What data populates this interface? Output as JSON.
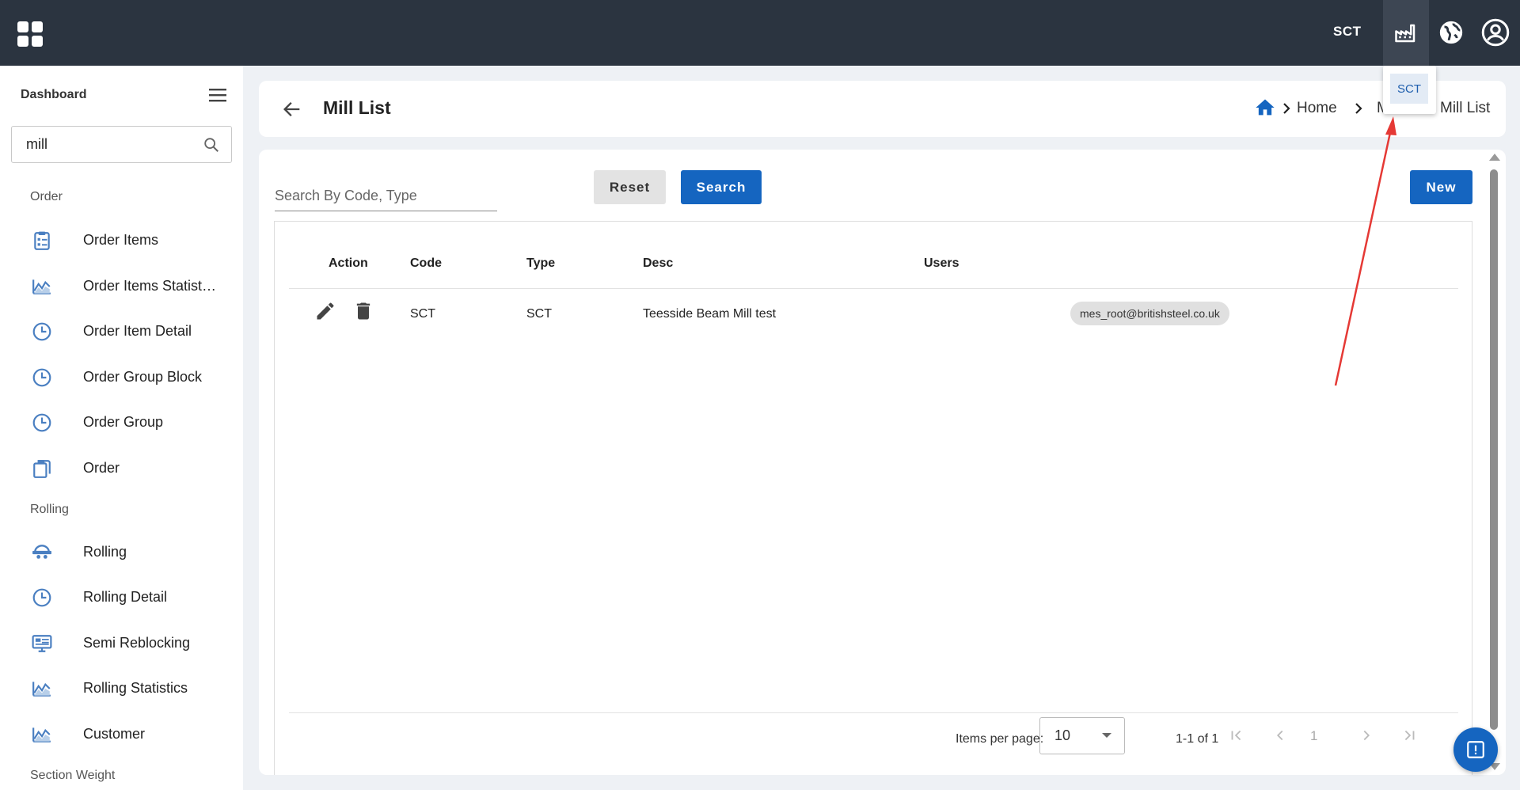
{
  "topbar": {
    "mill_code": "SCT",
    "mill_dropdown": {
      "options": [
        "SCT"
      ],
      "selected": "SCT"
    }
  },
  "sidebar": {
    "title": "Dashboard",
    "search": {
      "value": "mill",
      "placeholder": ""
    },
    "sections": [
      {
        "label": "Order"
      },
      {
        "label": "Rolling"
      },
      {
        "label": "Section Weight"
      }
    ],
    "items": [
      {
        "label": "Order Items",
        "icon": "clipboard-list-icon"
      },
      {
        "label": "Order Items Statistics",
        "icon": "chart-icon"
      },
      {
        "label": "Order Item Detail",
        "icon": "clock-icon"
      },
      {
        "label": "Order Group Block",
        "icon": "clock-icon"
      },
      {
        "label": "Order Group",
        "icon": "clock-icon"
      },
      {
        "label": "Order",
        "icon": "clipboard-icon"
      },
      {
        "label": "Rolling",
        "icon": "rolling-icon"
      },
      {
        "label": "Rolling Detail",
        "icon": "clock-icon"
      },
      {
        "label": "Semi Reblocking",
        "icon": "monitor-icon"
      },
      {
        "label": "Rolling Statistics",
        "icon": "chart-icon"
      },
      {
        "label": "Customer",
        "icon": "chart-icon"
      }
    ]
  },
  "header": {
    "title": "Mill List",
    "breadcrumb": {
      "home": "Home",
      "middle": "M",
      "current": "Mill List"
    }
  },
  "toolbar": {
    "search_placeholder": "Search By Code, Type",
    "reset_label": "Reset",
    "search_label": "Search",
    "new_label": "New"
  },
  "table": {
    "columns": [
      "Action",
      "Code",
      "Type",
      "Desc",
      "Users"
    ],
    "rows": [
      {
        "code": "SCT",
        "type": "SCT",
        "desc": "Teesside Beam Mill test",
        "users": [
          "mes_root@britishsteel.co.uk"
        ]
      }
    ]
  },
  "pagination": {
    "items_per_page_label": "Items per page:",
    "items_per_page": "10",
    "range": "1-1 of 1",
    "page": "1"
  },
  "colors": {
    "topbar": "#2b3440",
    "primary": "#1565c0",
    "annotation": "#e53935"
  }
}
